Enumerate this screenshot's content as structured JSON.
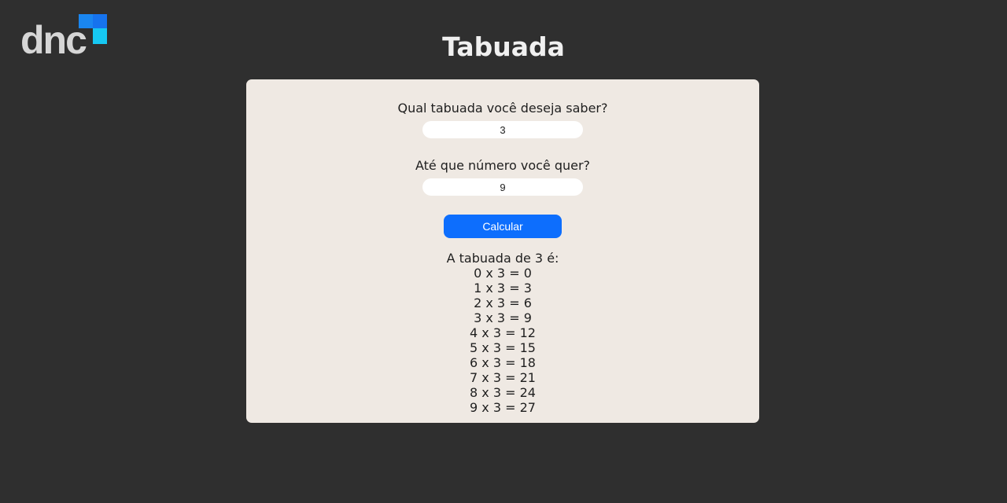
{
  "brand": {
    "logo_text": "dnc",
    "colors": {
      "background": "#2f2f2f",
      "card": "#efe9e3",
      "button": "#0d6efd",
      "logo_blue_dark": "#1877f2",
      "logo_blue_light": "#18c3ef"
    }
  },
  "header": {
    "title": "Tabuada"
  },
  "form": {
    "question_table": "Qual tabuada você deseja saber?",
    "table_value": "3",
    "question_limit": "Até que número você quer?",
    "limit_value": "9",
    "button_label": "Calcular"
  },
  "result": {
    "heading": "A tabuada de 3 é:",
    "lines": [
      "0 x 3 = 0",
      "1 x 3 = 3",
      "2 x 3 = 6",
      "3 x 3 = 9",
      "4 x 3 = 12",
      "5 x 3 = 15",
      "6 x 3 = 18",
      "7 x 3 = 21",
      "8 x 3 = 24",
      "9 x 3 = 27"
    ]
  }
}
